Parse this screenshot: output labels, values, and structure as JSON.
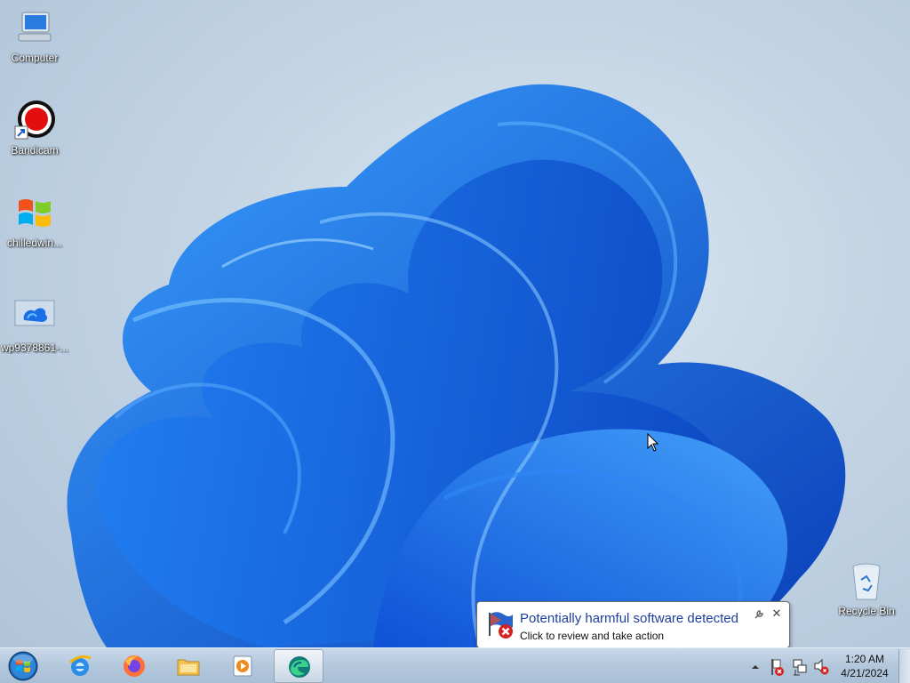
{
  "desktop": {
    "icons": [
      {
        "label": "Computer",
        "icon": "computer-icon"
      },
      {
        "label": "Bandicam",
        "icon": "bandicam-icon"
      },
      {
        "label": "chilledwin...",
        "icon": "windows-flag-icon"
      },
      {
        "label": "wp9378861-...",
        "icon": "image-file-icon"
      },
      {
        "label": "Recycle Bin",
        "icon": "recycle-bin-icon"
      }
    ]
  },
  "taskbar": {
    "start_icon": "windows-start-orb-icon",
    "pinned": [
      {
        "name": "internet-explorer",
        "icon": "ie-icon"
      },
      {
        "name": "firefox",
        "icon": "firefox-icon"
      },
      {
        "name": "file-explorer",
        "icon": "folder-icon"
      },
      {
        "name": "media-player",
        "icon": "media-player-icon"
      },
      {
        "name": "active-app",
        "icon": "edge-icon",
        "active": true
      }
    ],
    "tray": {
      "icons": [
        "show-hidden-icons-arrow",
        "action-center-flag-error-icon",
        "network-icon",
        "volume-muted-icon"
      ],
      "time": "1:20 AM",
      "date": "4/21/2024"
    }
  },
  "notification": {
    "title": "Potentially harmful software detected",
    "body": "Click to review and take action",
    "icon": "security-flag-error-icon"
  },
  "colors": {
    "balloon_title": "#1e3f9e",
    "wallpaper_blue": "#1565e0"
  }
}
